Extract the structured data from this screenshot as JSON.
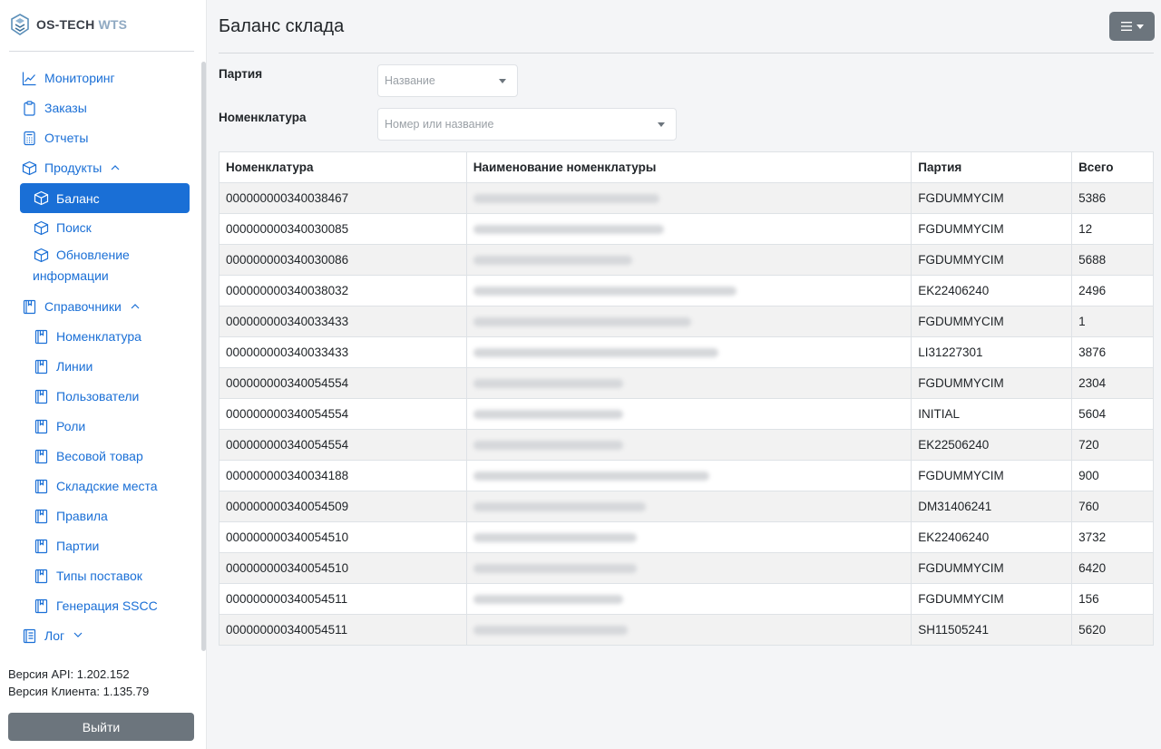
{
  "app": {
    "brand_main": "OS-TECH",
    "brand_accent": "WTS"
  },
  "sidebar": {
    "items": [
      {
        "label": "Мониторинг",
        "icon": "chart-line-icon"
      },
      {
        "label": "Заказы",
        "icon": "clipboard-icon"
      },
      {
        "label": "Отчеты",
        "icon": "calculator-icon"
      },
      {
        "label": "Продукты",
        "icon": "box-icon",
        "expanded": true
      },
      {
        "label": "Баланс",
        "icon": "box-icon",
        "active": true
      },
      {
        "label": "Поиск",
        "icon": "box-icon"
      },
      {
        "label": "Обновление",
        "label2": "информации",
        "icon": "box-icon"
      },
      {
        "label": "Справочники",
        "icon": "book-icon",
        "expanded": true
      },
      {
        "label": "Номенклатура",
        "icon": "book-icon"
      },
      {
        "label": "Линии",
        "icon": "book-icon"
      },
      {
        "label": "Пользователи",
        "icon": "book-icon"
      },
      {
        "label": "Роли",
        "icon": "book-icon"
      },
      {
        "label": "Весовой товар",
        "icon": "book-icon"
      },
      {
        "label": "Складские места",
        "icon": "book-icon"
      },
      {
        "label": "Правила",
        "icon": "book-icon"
      },
      {
        "label": "Партии",
        "icon": "book-icon"
      },
      {
        "label": "Типы поставок",
        "icon": "book-icon"
      },
      {
        "label": "Генерация SSCC",
        "icon": "book-icon"
      },
      {
        "label": "Лог",
        "icon": "log-icon",
        "expanded": false
      }
    ],
    "api_version": "Версия API: 1.202.152",
    "client_version": "Версия Клиента: 1.135.79",
    "logout_label": "Выйти"
  },
  "main": {
    "title": "Баланс склада",
    "filters": {
      "batch_label": "Партия",
      "batch_placeholder": "Название",
      "nomenclature_label": "Номенклатура",
      "nomenclature_placeholder": "Номер или название"
    },
    "table": {
      "headers": [
        "Номенклатура",
        "Наименование номенклатуры",
        "Партия",
        "Всего"
      ],
      "rows": [
        [
          "000000000340038467",
          "",
          "FGDUMMYCIM",
          "5386"
        ],
        [
          "000000000340030085",
          "",
          "FGDUMMYCIM",
          "12"
        ],
        [
          "000000000340030086",
          "",
          "FGDUMMYCIM",
          "5688"
        ],
        [
          "000000000340038032",
          "",
          "EK22406240",
          "2496"
        ],
        [
          "000000000340033433",
          "",
          "FGDUMMYCIM",
          "1"
        ],
        [
          "000000000340033433",
          "",
          "LI31227301",
          "3876"
        ],
        [
          "000000000340054554",
          "",
          "FGDUMMYCIM",
          "2304"
        ],
        [
          "000000000340054554",
          "",
          "INITIAL",
          "5604"
        ],
        [
          "000000000340054554",
          "",
          "EK22506240",
          "720"
        ],
        [
          "000000000340034188",
          "",
          "FGDUMMYCIM",
          "900"
        ],
        [
          "000000000340054509",
          "",
          "DM31406241",
          "760"
        ],
        [
          "000000000340054510",
          "",
          "EK22406240",
          "3732"
        ],
        [
          "000000000340054510",
          "",
          "FGDUMMYCIM",
          "6420"
        ],
        [
          "000000000340054511",
          "",
          "FGDUMMYCIM",
          "156"
        ],
        [
          "000000000340054511",
          "",
          "SH11505241",
          "5620"
        ]
      ]
    }
  },
  "colors": {
    "accent": "#1a6fd6",
    "button_gray": "#6c757d"
  }
}
